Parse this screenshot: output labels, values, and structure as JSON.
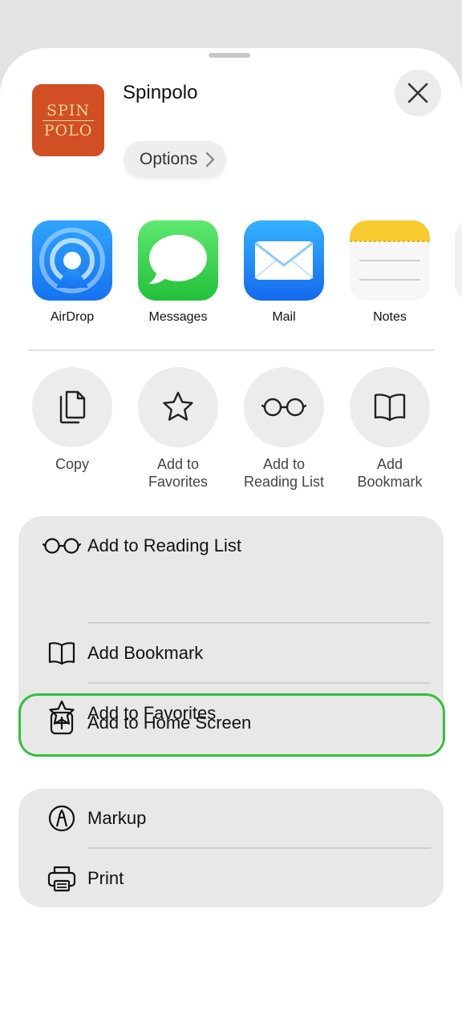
{
  "sheet": {
    "app_title": "Spinpolo",
    "app_icon_text": [
      "SPIN",
      "POLO"
    ],
    "options_label": "Options",
    "close_icon": "close-icon"
  },
  "apps": [
    {
      "label": "AirDrop",
      "icon": "airdrop-icon"
    },
    {
      "label": "Messages",
      "icon": "messages-icon"
    },
    {
      "label": "Mail",
      "icon": "mail-icon"
    },
    {
      "label": "Notes",
      "icon": "notes-icon"
    }
  ],
  "actions": [
    {
      "label": "Copy",
      "icon": "copy-icon"
    },
    {
      "label": "Add to Favorites",
      "icon": "star-icon"
    },
    {
      "label": "Add to Reading List",
      "icon": "glasses-icon"
    },
    {
      "label": "Add Bookmark",
      "icon": "book-icon"
    }
  ],
  "list1": [
    {
      "label": "Add to Reading List",
      "icon": "glasses-icon"
    },
    {
      "label": "Add Bookmark",
      "icon": "book-icon"
    },
    {
      "label": "Add to Favorites",
      "icon": "star-icon"
    },
    {
      "label": "Add to Home Screen",
      "icon": "plus-square-icon",
      "highlighted": true
    }
  ],
  "list2": [
    {
      "label": "Markup",
      "icon": "markup-icon"
    },
    {
      "label": "Print",
      "icon": "printer-icon"
    }
  ],
  "colors": {
    "highlight": "#33c13c",
    "app_icon_bg": "#d24f24"
  }
}
